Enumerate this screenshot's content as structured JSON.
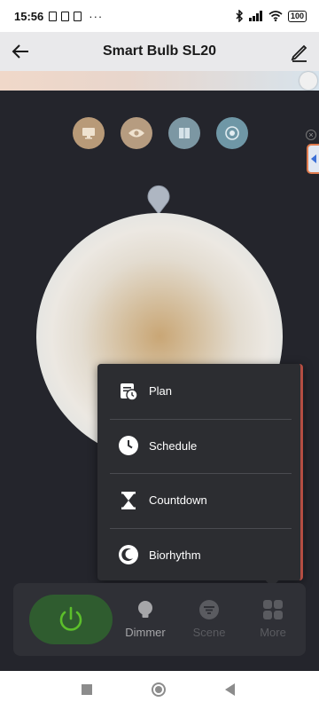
{
  "status_bar": {
    "time": "15:56",
    "dots": "···",
    "battery": "100"
  },
  "app_bar": {
    "title": "Smart Bulb SL20"
  },
  "modes": [
    {
      "name": "computer",
      "icon": "monitor-icon",
      "color": "#b89a78"
    },
    {
      "name": "eye",
      "icon": "eye-icon",
      "color": "#b69c80"
    },
    {
      "name": "reading",
      "icon": "book-icon",
      "color": "#7c97a3"
    },
    {
      "name": "spotlight",
      "icon": "target-icon",
      "color": "#6f97a6"
    }
  ],
  "menu": {
    "items": [
      {
        "label": "Plan",
        "icon": "calendar-clock-icon"
      },
      {
        "label": "Schedule",
        "icon": "clock-icon"
      },
      {
        "label": "Countdown",
        "icon": "hourglass-icon"
      },
      {
        "label": "Biorhythm",
        "icon": "moon-clock-icon"
      }
    ]
  },
  "tabs": {
    "dimmer": "Dimmer",
    "scene": "Scene",
    "more": "More"
  },
  "colors": {
    "power_on": "#5cbf2a",
    "menu_accent": "#b44d42",
    "side_tab_border": "#e07b4e"
  }
}
